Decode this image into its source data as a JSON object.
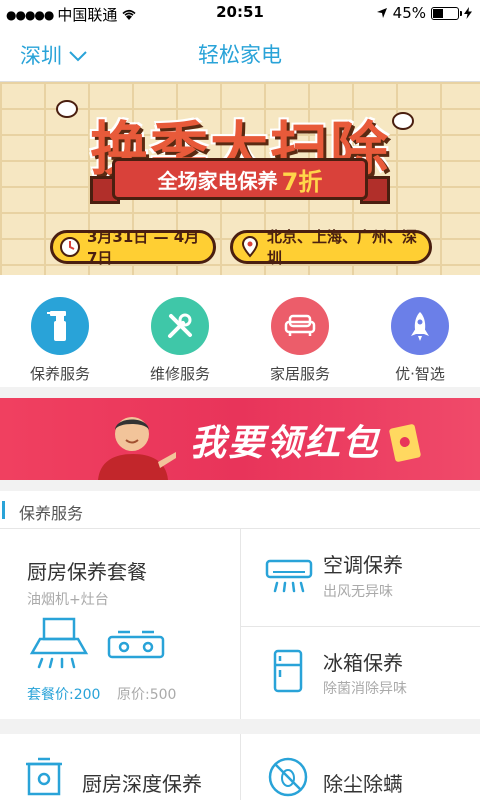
{
  "status_bar": {
    "carrier": "中国联通",
    "time": "20:51",
    "battery": "45%",
    "battery_level": 0.45
  },
  "nav": {
    "city": "深圳",
    "title": "轻松家电"
  },
  "banner_promo": {
    "headline": "换季大扫除",
    "discount_text": "全场家电保养",
    "discount_highlight": "7折",
    "dates": "3月31日 — 4月7日",
    "cities": "北京、上海、广州、深圳",
    "colors": {
      "headline": "#e85a3a",
      "ribbon": "#d9413a",
      "pill": "#ffcf33"
    }
  },
  "categories": [
    {
      "label": "保养服务",
      "icon": "spray-bottle-icon",
      "color": "#29a3d8"
    },
    {
      "label": "维修服务",
      "icon": "tools-icon",
      "color": "#3fc7a8"
    },
    {
      "label": "家居服务",
      "icon": "sofa-icon",
      "color": "#ec5d6a"
    },
    {
      "label": "优·智选",
      "icon": "rocket-icon",
      "color": "#6b7fe8"
    }
  ],
  "banner_redpacket": {
    "slogan": "我要领红包"
  },
  "section": {
    "title": "保养服务"
  },
  "services": {
    "kitchen_package": {
      "title": "厨房保养套餐",
      "subtitle": "油烟机+灶台",
      "package_price": "套餐价:200",
      "original_price": "原价:500"
    },
    "aircon": {
      "title": "空调保养",
      "subtitle": "出风无异味",
      "icon": "air-conditioner-icon"
    },
    "fridge": {
      "title": "冰箱保养",
      "subtitle": "除菌消除异味",
      "icon": "fridge-icon"
    },
    "kitchen_deep": {
      "title": "厨房深度保养",
      "icon": "kitchen-pot-icon"
    },
    "mite": {
      "title": "除尘除螨",
      "icon": "mite-icon"
    }
  },
  "accent_color": "#29a3d8"
}
